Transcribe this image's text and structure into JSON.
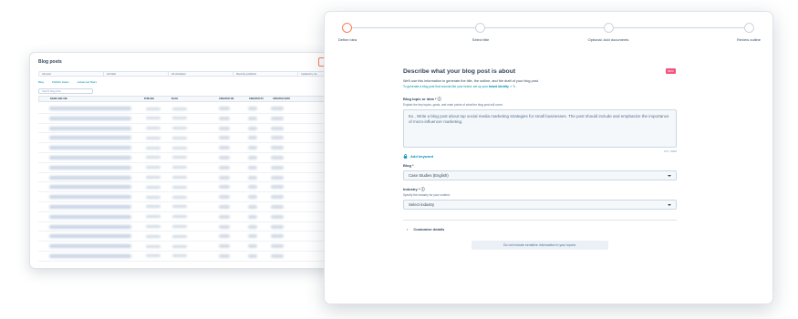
{
  "list_window": {
    "title": "Blog posts",
    "start_ai_button": "Start with AI",
    "views": [
      "All posts",
      "All drafts",
      "All scheduled",
      "Recently published",
      "Updated by me"
    ],
    "view_links": [
      "Add view",
      "All views"
    ],
    "filters": [
      "Blog",
      "Publish status",
      "Advanced filters"
    ],
    "search_placeholder": "Search blog posts",
    "columns": [
      "NAME AND URL",
      "PUBLISH",
      "BLOG",
      "CREATED ON",
      "CREATED BY",
      "UPDATED DATE"
    ]
  },
  "wizard": {
    "steps": [
      {
        "label": "Define idea",
        "active": true
      },
      {
        "label": "Select title",
        "active": false
      },
      {
        "label": "Optional: Add documents",
        "active": false
      },
      {
        "label": "Review outline",
        "active": false
      }
    ],
    "title": "Describe what your blog post is about",
    "badge": "BETA",
    "subtitle": "We'll use this information to generate the title, the outline, and the draft of your blog post.",
    "brand_note_prefix": "To generate a blog post that sounds like your brand, set up your",
    "brand_note_link": "brand identity",
    "topic_label": "Blog topic or idea *",
    "topic_help": "Explain the key topics, goals, and main points of what the blog post will cover.",
    "topic_value": "Ex., Write a blog post about top social media marketing strategies for small businesses. The post should include and emphasize the importance of micro-influencer marketing.",
    "char_count": "272 / 5000",
    "add_keyword": "Add keyword",
    "blog_label": "Blog *",
    "blog_value": "Case Studies (English)",
    "industry_label": "Industry *",
    "industry_help": "Specify the industry for your content.",
    "industry_value": "Select industry",
    "customize": "Customize details",
    "privacy_note": "Do not include sensitive information in your inputs."
  },
  "colors": {
    "accent": "#ff7a59",
    "link": "#0091ae",
    "text": "#33475b",
    "badge": "#f2547d"
  }
}
